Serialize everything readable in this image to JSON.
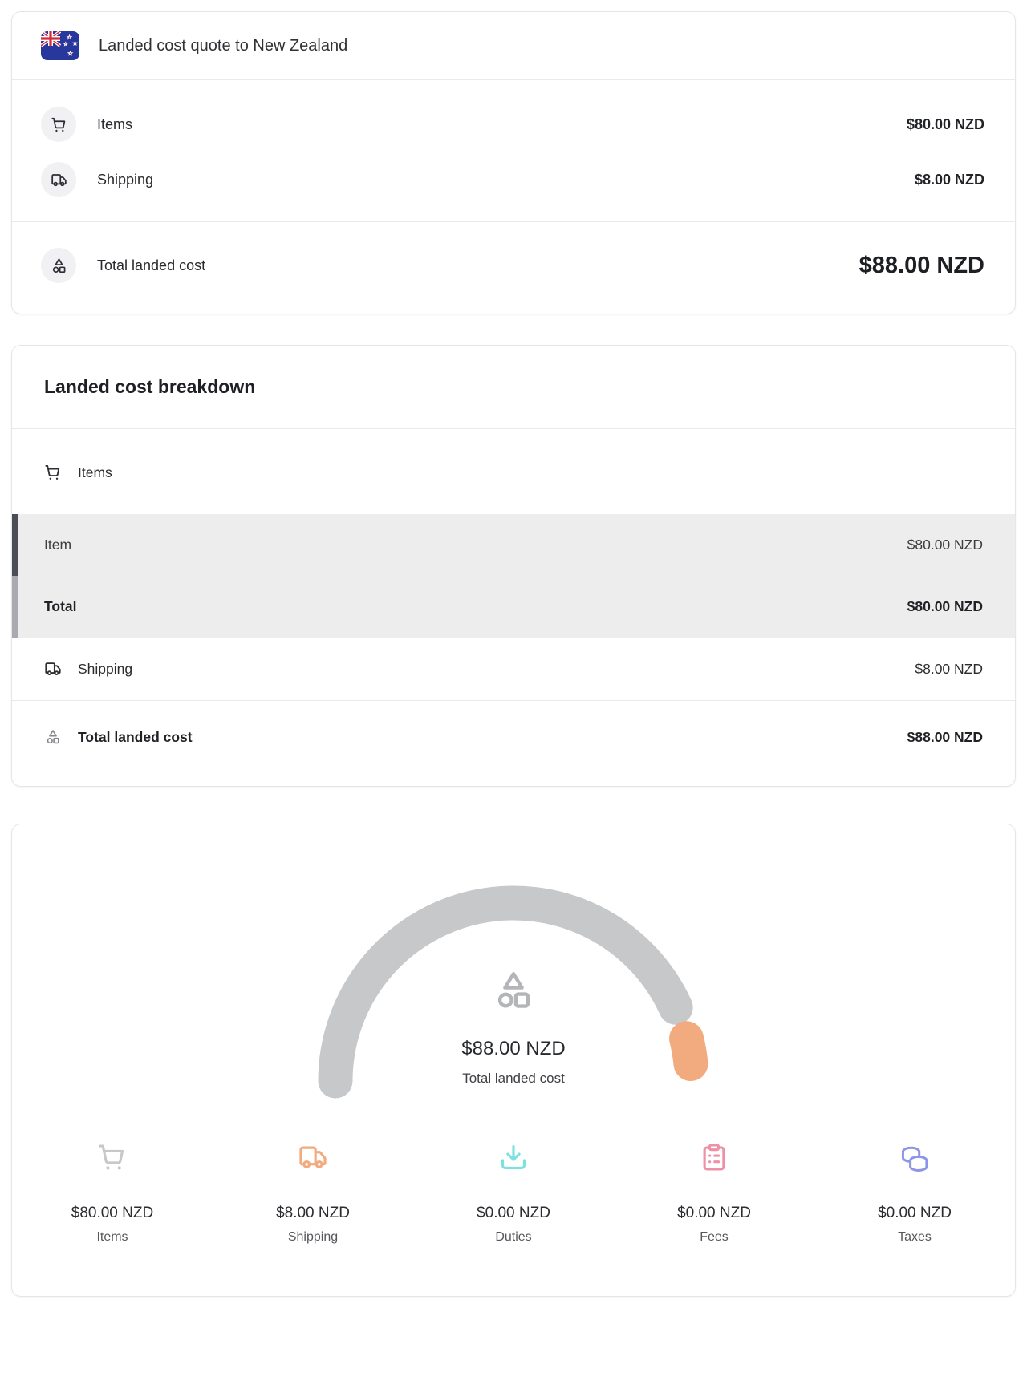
{
  "quote_card": {
    "title": "Landed cost quote to New Zealand",
    "rows": [
      {
        "icon": "cart-icon",
        "label": "Items",
        "value": "$80.00 NZD"
      },
      {
        "icon": "truck-icon",
        "label": "Shipping",
        "value": "$8.00 NZD"
      }
    ],
    "total_row": {
      "icon": "shapes-icon",
      "label": "Total landed cost",
      "value": "$88.00 NZD"
    }
  },
  "breakdown_card": {
    "title": "Landed cost breakdown",
    "items_section": {
      "header": "Items",
      "rows": [
        {
          "label": "Item",
          "value": "$80.00 NZD",
          "emphasis": "normal"
        },
        {
          "label": "Total",
          "value": "$80.00 NZD",
          "emphasis": "bold"
        }
      ]
    },
    "shipping_row": {
      "label": "Shipping",
      "value": "$8.00 NZD"
    },
    "total_row": {
      "label": "Total landed cost",
      "value": "$88.00 NZD"
    }
  },
  "chart_card": {
    "center_value": "$88.00 NZD",
    "center_label": "Total landed cost",
    "stats": [
      {
        "icon": "cart-icon",
        "value": "$80.00 NZD",
        "label": "Items",
        "color": "#c7c8ca"
      },
      {
        "icon": "truck-icon",
        "value": "$8.00 NZD",
        "label": "Shipping",
        "color": "#f2ab7e"
      },
      {
        "icon": "download-icon",
        "value": "$0.00 NZD",
        "label": "Duties",
        "color": "#7ce2de"
      },
      {
        "icon": "clipboard-icon",
        "value": "$0.00 NZD",
        "label": "Fees",
        "color": "#ee90a6"
      },
      {
        "icon": "coins-icon",
        "value": "$0.00 NZD",
        "label": "Taxes",
        "color": "#8d95e9"
      }
    ]
  },
  "chart_data": {
    "type": "gauge",
    "title": "Total landed cost",
    "center_value": "$88.00 NZD",
    "currency": "NZD",
    "total": 88.0,
    "arc_degrees": 180,
    "segments": [
      {
        "name": "Items",
        "value": 80.0,
        "color": "#c7c8ca"
      },
      {
        "name": "Shipping",
        "value": 8.0,
        "color": "#f2ab7e"
      },
      {
        "name": "Duties",
        "value": 0.0,
        "color": "#7ce2de"
      },
      {
        "name": "Fees",
        "value": 0.0,
        "color": "#ee90a6"
      },
      {
        "name": "Taxes",
        "value": 0.0,
        "color": "#8d95e9"
      }
    ]
  },
  "colors": {
    "card_border": "#e5e6e8",
    "row_highlight_bg": "#ededee",
    "highlight_border_dark": "#4b4e54",
    "highlight_border_light": "#a9abb0",
    "flag_blue": "#28379b",
    "flag_red": "#d32b3a"
  }
}
